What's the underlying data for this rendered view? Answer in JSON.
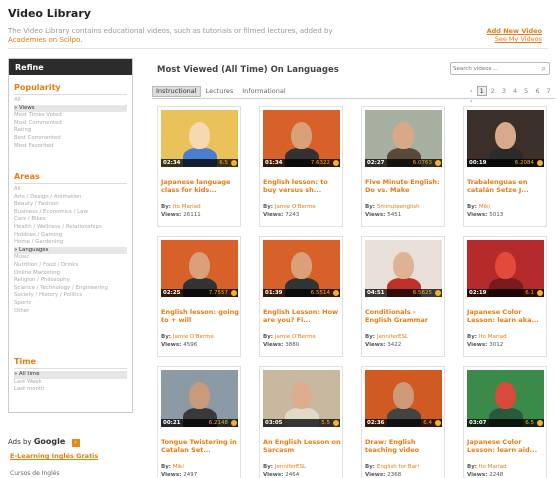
{
  "header": {
    "title": "Video Library",
    "description_prefix": "The Video Library contains educational videos, such as tutorials or filmed lectures, added by",
    "description_link": "Academies on Scilpo.",
    "add_label": "Add New Video",
    "see_label": "See My Videos"
  },
  "sidebar": {
    "refine_label": "Refine",
    "popularity": {
      "heading": "Popularity",
      "items": [
        "All",
        "Views",
        "Most Times Voted",
        "Most Commented",
        "Rating",
        "Best Commented",
        "Most Favorited"
      ],
      "selected": "Views"
    },
    "areas": {
      "heading": "Areas",
      "items": [
        "All",
        "Arts / Design / Animation",
        "Beauty / Fashion",
        "Business / Economics / Law",
        "Cars / Bikes",
        "Health / Wellness / Relationships",
        "Hobbies / Gaming",
        "Home / Gardening",
        "Languages",
        "Music",
        "Nutrition / Food / Drinks",
        "Online Marketing",
        "Religion / Philosophy",
        "Science / Technology / Engineering",
        "Society / History / Politics",
        "Sports",
        "Other"
      ],
      "selected": "Languages"
    },
    "time": {
      "heading": "Time",
      "items": [
        "All time",
        "Last Week",
        "Last month"
      ],
      "selected": "All time"
    }
  },
  "main": {
    "title": "Most Viewed (All Time) On Languages",
    "search_placeholder": "Search videos ...",
    "tabs": [
      "Instructional",
      "Lectures",
      "Informational"
    ],
    "active_tab": "Instructional",
    "pager": [
      "‹",
      "1",
      "2",
      "3",
      "4",
      "5",
      "6",
      "7",
      "›"
    ],
    "current_page": "1",
    "by_label": "By:",
    "views_label": "Views:",
    "videos": [
      {
        "title": "Japanese language class for kids...",
        "author": "Ito Mariad",
        "views": "26111",
        "duration": "02:34",
        "rating": "6.5",
        "thumb": "cartoon"
      },
      {
        "title": "English lesson: to buy versus sh...",
        "author": "Jamie O'Berme",
        "views": "7243",
        "duration": "01:34",
        "rating": "7.6322",
        "thumb": "man-orange"
      },
      {
        "title": "Five Minute English: Do vs. Make",
        "author": "5minuteenglish",
        "views": "5451",
        "duration": "02:27",
        "rating": "6.0763",
        "thumb": "man-room"
      },
      {
        "title": "Trabalenguas en catalán Setze J...",
        "author": "Miki",
        "views": "5013",
        "duration": "00:19",
        "rating": "6.2084",
        "thumb": "woman-dark"
      },
      {
        "title": "English lesson: going to + will",
        "author": "Jamie O'Berme",
        "views": "4596",
        "duration": "02:25",
        "rating": "7.7557",
        "thumb": "man-orange"
      },
      {
        "title": "English Lesson: How are you? Fi...",
        "author": "Jamie O'Berme",
        "views": "3880",
        "duration": "01:39",
        "rating": "6.5514",
        "thumb": "man-orange"
      },
      {
        "title": "Conditionals - English Grammar",
        "author": "JenniferESL",
        "views": "3422",
        "duration": "04:51",
        "rating": "6.5625",
        "thumb": "woman-red"
      },
      {
        "title": "Japanese Color Lesson: learn aka...",
        "author": "Ito Mariad",
        "views": "3012",
        "duration": "02:19",
        "rating": "6.1",
        "thumb": "red-objects"
      },
      {
        "title": "Tongue Twistering in Catalan Set...",
        "author": "Miki",
        "views": "2497",
        "duration": "00:21",
        "rating": "6.2148",
        "thumb": "man-window"
      },
      {
        "title": "An English Lesson on Sarcasm",
        "author": "JenniferESL",
        "views": "2464",
        "duration": "03:05",
        "rating": "5.5",
        "thumb": "woman-room"
      },
      {
        "title": "Draw: English teaching video",
        "author": "English for Bar!",
        "views": "2368",
        "duration": "02:36",
        "rating": "6.4",
        "thumb": "man-orange2"
      },
      {
        "title": "Japanese Color Lesson: learn aid...",
        "author": "Ito Mariad",
        "views": "2248",
        "duration": "03:07",
        "rating": "6.5",
        "thumb": "green-objects"
      }
    ]
  },
  "ads": {
    "label": "Ads by",
    "brand": "Google",
    "link": "E-Learning Inglés Gratis",
    "sub": "Cursos de Inglés"
  },
  "colors": {
    "accent": "#e87b10",
    "refine_bg": "#2c2c2c"
  }
}
